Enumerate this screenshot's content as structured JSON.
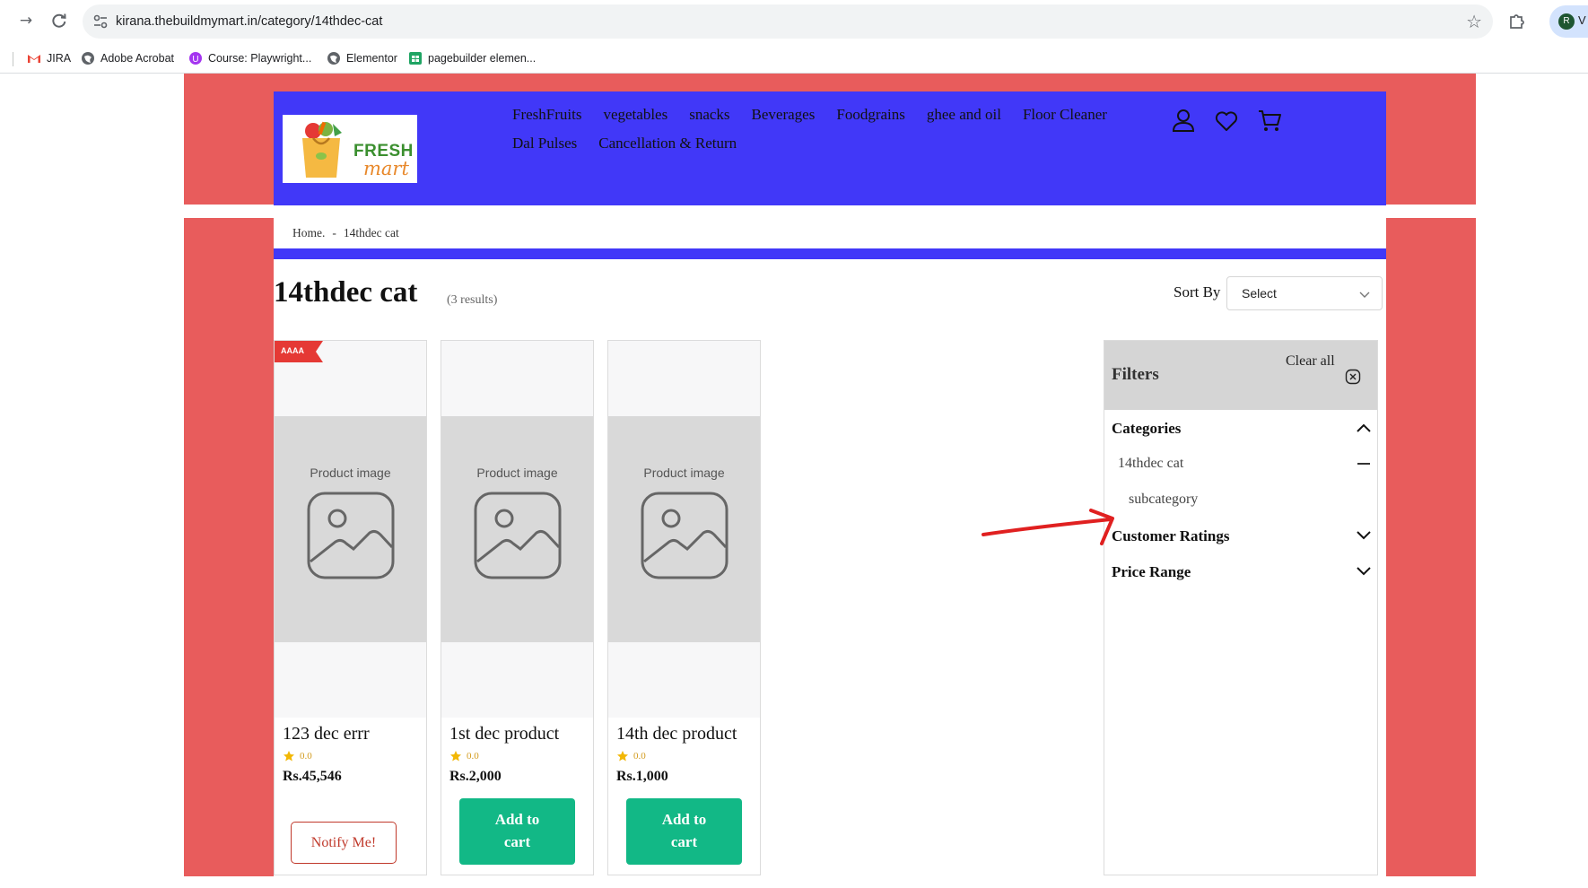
{
  "browser": {
    "url": "kirana.thebuildmymart.in/category/14thdec-cat",
    "profile_initial": "R",
    "profile_text": "V",
    "bookmarks": [
      {
        "label": "JIRA",
        "icon": "gmail-icon"
      },
      {
        "label": "Adobe Acrobat",
        "icon": "globe-icon"
      },
      {
        "label": "Course: Playwright...",
        "icon": "course-icon"
      },
      {
        "label": "Elementor",
        "icon": "globe-icon"
      },
      {
        "label": "pagebuilder elemen...",
        "icon": "sheets-icon"
      }
    ]
  },
  "header": {
    "logo": {
      "word1": "FRESH",
      "word2": "mart"
    },
    "menu_row1": [
      "FreshFruits",
      "vegetables",
      "snacks",
      "Beverages",
      "Foodgrains",
      "ghee and oil",
      "Floor Cleaner"
    ],
    "menu_row2": [
      "Dal Pulses",
      "Cancellation & Return"
    ]
  },
  "breadcrumb": {
    "home": "Home.",
    "separator": "-",
    "current": "14thdec cat"
  },
  "page": {
    "title": "14thdec cat",
    "results": "(3 results)"
  },
  "sort": {
    "label": "Sort By",
    "value": "Select"
  },
  "products": [
    {
      "name": "123 dec errr",
      "rating": "0.0",
      "price": "Rs.45,546",
      "image_label": "Product image",
      "badge": "AAAA",
      "action": "Notify Me!"
    },
    {
      "name": "1st dec product",
      "rating": "0.0",
      "price": "Rs.2,000",
      "image_label": "Product image",
      "action": "Add to cart"
    },
    {
      "name": "14th dec product",
      "rating": "0.0",
      "price": "Rs.1,000",
      "image_label": "Product image",
      "action": "Add to cart"
    }
  ],
  "filters": {
    "title": "Filters",
    "clear_all": "Clear all",
    "categories": {
      "label": "Categories",
      "item": "14thdec cat",
      "sub": "subcategory"
    },
    "ratings": {
      "label": "Customer Ratings"
    },
    "price": {
      "label": "Price Range"
    }
  },
  "colors": {
    "brand_blue": "#4138f8",
    "side_red": "#e85c5c",
    "cart_green": "#12b886",
    "notify_red": "#c0392b"
  }
}
